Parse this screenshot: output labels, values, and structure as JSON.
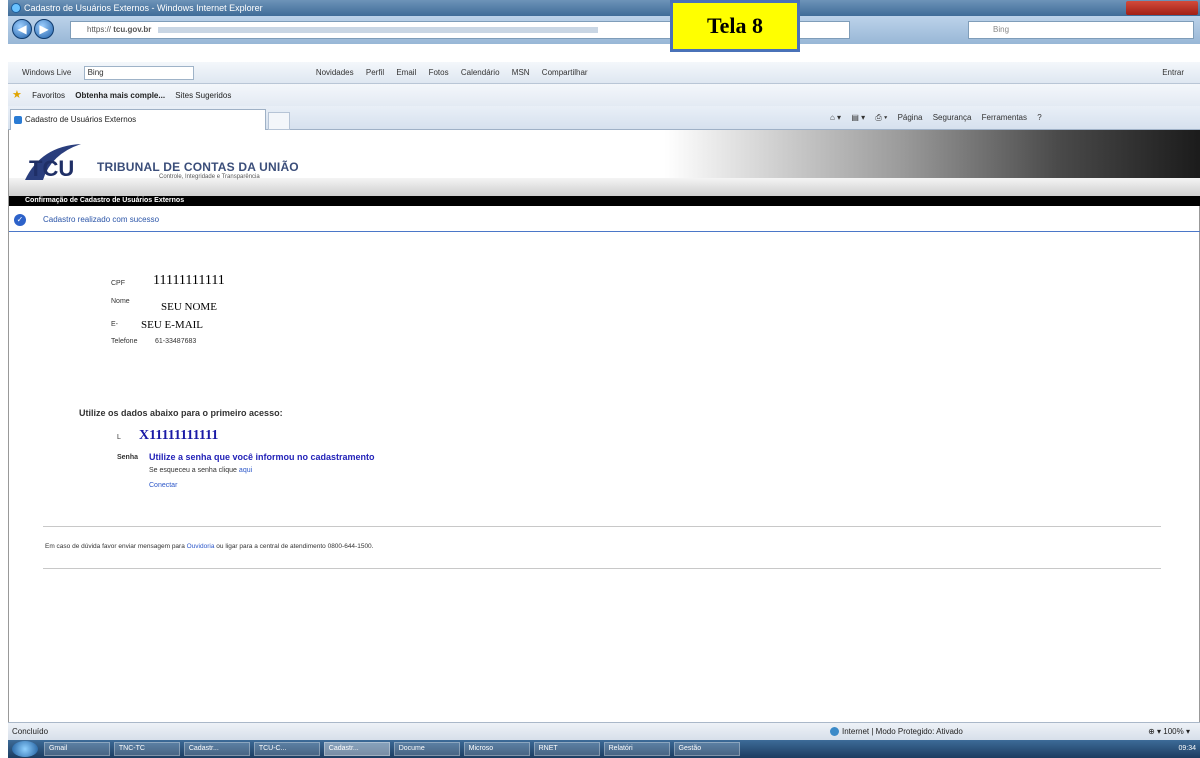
{
  "window": {
    "title": "Cadastro de Usuários Externos - Windows Internet Explorer"
  },
  "address": {
    "url_prefix": "https://",
    "url_domain": "tcu.gov.br",
    "search_placeholder": "Bing"
  },
  "overlay": {
    "label": "Tela 8"
  },
  "wl_toolbar": {
    "brand": "Windows Live",
    "search": "Bing",
    "links": [
      "Novidades",
      "Perfil",
      "Email",
      "Fotos",
      "Calendário",
      "MSN",
      "Compartilhar"
    ],
    "right": "Entrar"
  },
  "favorites": {
    "label": "Favoritos",
    "items": [
      "Obtenha mais comple...",
      "Sites Sugeridos"
    ]
  },
  "tab": {
    "title": "Cadastro de Usuários Externos"
  },
  "commands": {
    "items": [
      "Página",
      "Segurança",
      "Ferramentas"
    ]
  },
  "banner": {
    "org": "TRIBUNAL DE CONTAS DA UNIÃO",
    "tagline": "Controle, Integridade e Transparência",
    "logo_text": "TCU"
  },
  "bar_title": "Confirmação de Cadastro de Usuários Externos",
  "success_msg": "Cadastro realizado com sucesso",
  "user": {
    "cpf_label": "CPF",
    "cpf_value": "11111111111",
    "nome_label": "Nome",
    "nome_value": "SEU NOME",
    "email_label": "E-",
    "email_value": "SEU E-MAIL",
    "tel_label": "Telefone",
    "tel_value": "61-33487683"
  },
  "access": {
    "title": "Utilize os dados abaixo para o primeiro acesso:",
    "login_label": "L",
    "login_value": "X11111111111",
    "senha_label": "Senha",
    "senha_value": "Utilize a senha que você informou no cadastramento",
    "hint_text": "Se esqueceu a senha clique",
    "hint_link": "aqui",
    "connect": "Conectar"
  },
  "footer": {
    "pre": "Em caso de dúvida favor enviar mensagem para",
    "link": "Ouvidoria",
    "post": "ou ligar para a central de atendimento 0800-644-1500."
  },
  "status": {
    "left": "Concluído",
    "zone": "Internet | Modo Protegido: Ativado",
    "zoom": "100%"
  },
  "taskbar": {
    "items": [
      "Gmail",
      "TNC-TC",
      "Cadastr...",
      "TCU-C...",
      "Cadastr...",
      "Docume",
      "Microso",
      "RNET",
      "Relatóri",
      "Gestão"
    ],
    "clock": "09:34"
  }
}
